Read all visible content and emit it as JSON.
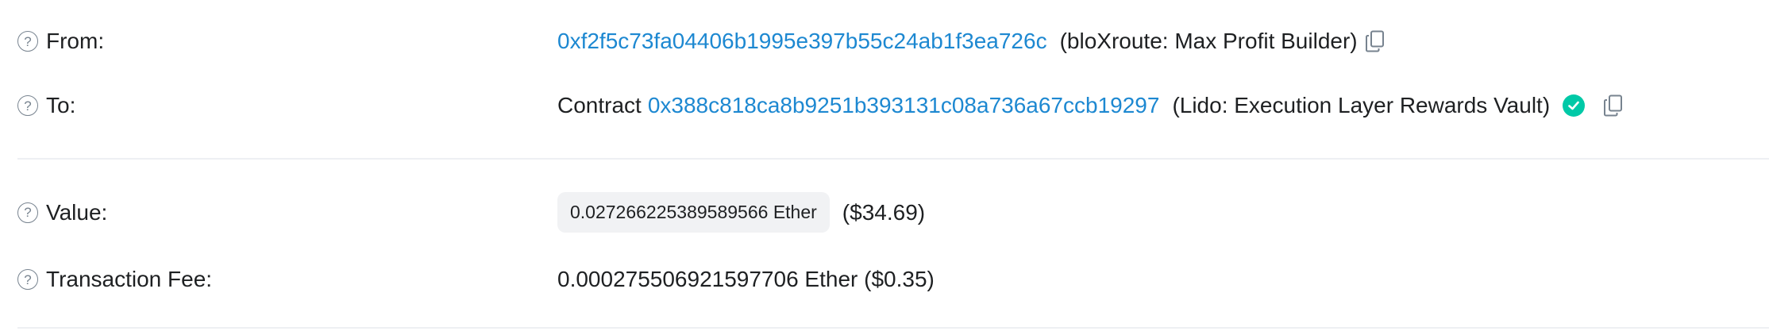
{
  "from": {
    "label": "From:",
    "address": "0xf2f5c73fa04406b1995e397b55c24ab1f3ea726c",
    "name_tag": "(bloXroute: Max Profit Builder)"
  },
  "to": {
    "label": "To:",
    "prefix": "Contract",
    "address": "0x388c818ca8b9251b393131c08a736a67ccb19297",
    "name_tag": "(Lido: Execution Layer Rewards Vault)"
  },
  "value": {
    "label": "Value:",
    "amount": "0.027266225389589566 Ether",
    "usd": "($34.69)"
  },
  "fee": {
    "label": "Transaction Fee:",
    "amount": "0.000275506921597706 Ether ($0.35)"
  },
  "icons": {
    "help": "question-circle-icon",
    "copy": "copy-icon",
    "verified": "check-circle-icon"
  },
  "colors": {
    "link": "#1d88d1",
    "verified": "#00c9a7",
    "muted": "#77838f",
    "pill_bg": "#f1f2f4"
  }
}
